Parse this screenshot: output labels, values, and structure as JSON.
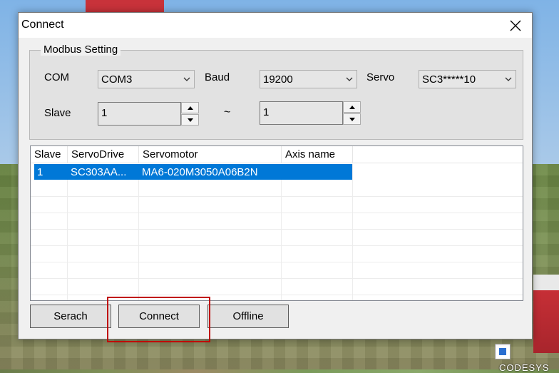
{
  "window": {
    "title": "Connect"
  },
  "modbus": {
    "group_label": "Modbus Setting",
    "com_label": "COM",
    "com_value": "COM3",
    "baud_label": "Baud",
    "baud_value": "19200",
    "servo_label": "Servo",
    "servo_value": "SC3*****10",
    "slave_label": "Slave",
    "slave_from": "1",
    "range_separator": "~",
    "slave_to": "1"
  },
  "table": {
    "columns": [
      "Slave",
      "ServoDrive",
      "Servomotor",
      "Axis name"
    ],
    "rows": [
      {
        "slave": "1",
        "servodrive": "SC303AA...",
        "servomotor": "MA6-020M3050A06B2N",
        "axis_name": ""
      }
    ]
  },
  "buttons": {
    "search": "Serach",
    "connect": "Connect",
    "offline": "Offline"
  },
  "desktop": {
    "icon_label": "CODESYS"
  },
  "colors": {
    "selection": "#0078d7",
    "highlight_box": "#c00000",
    "dialog_bg": "#f0f0f0"
  }
}
